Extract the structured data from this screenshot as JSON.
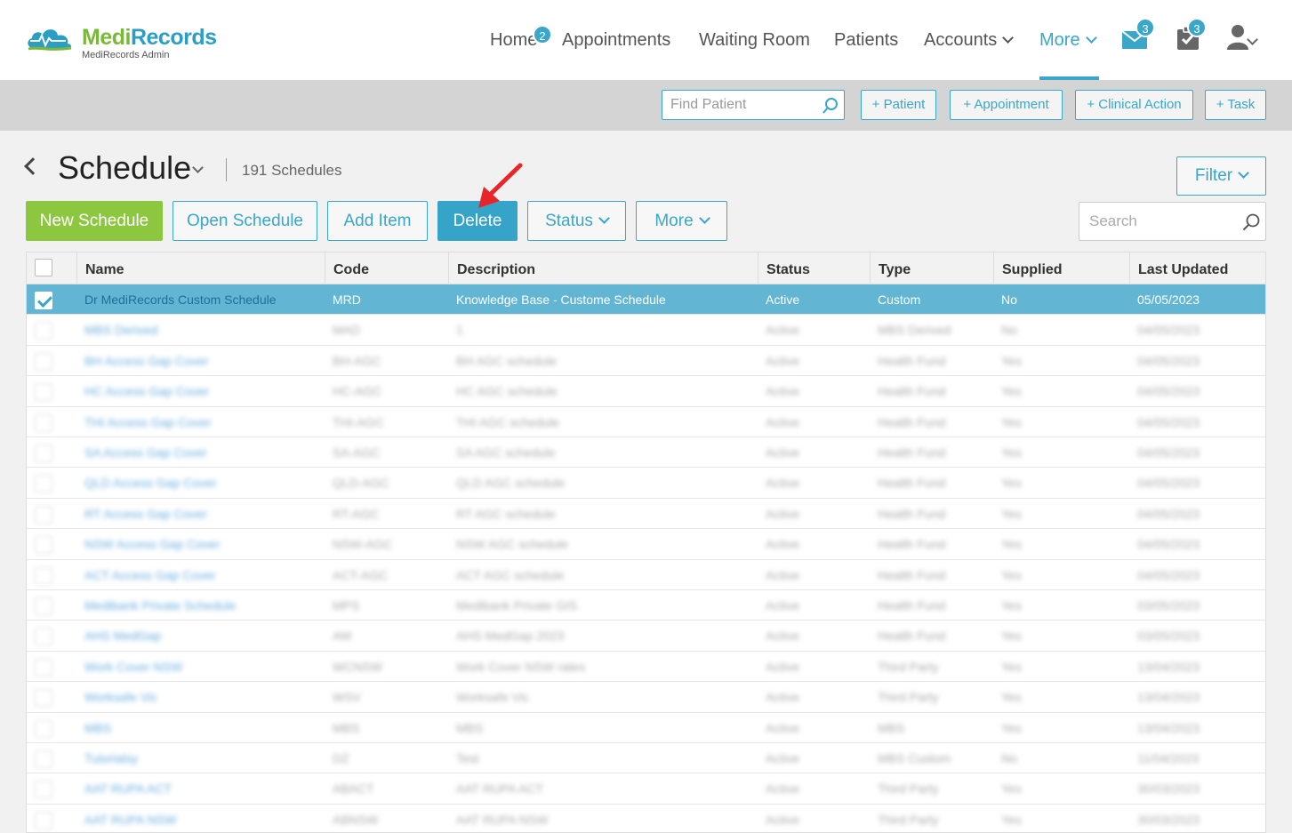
{
  "app": {
    "brand_part1": "Medi",
    "brand_part2": "Records",
    "subtitle": "MediRecords Admin"
  },
  "nav": {
    "home": "Home",
    "home_badge": "2",
    "appointments": "Appointments",
    "waiting_room": "Waiting Room",
    "patients": "Patients",
    "accounts": "Accounts",
    "more": "More",
    "messages_badge": "3",
    "tasks_badge": "3"
  },
  "toolbar": {
    "find_placeholder": "Find Patient",
    "add_patient": "+ Patient",
    "add_appointment": "+ Appointment",
    "add_clinical_action": "+ Clinical Action",
    "add_task": "+ Task"
  },
  "page": {
    "title": "Schedule",
    "count": "191 Schedules",
    "filter": "Filter"
  },
  "actions": {
    "new_schedule": "New Schedule",
    "open_schedule": "Open Schedule",
    "add_item": "Add Item",
    "delete": "Delete",
    "status": "Status",
    "more": "More",
    "search_placeholder": "Search"
  },
  "table": {
    "headers": [
      "Name",
      "Code",
      "Description",
      "Status",
      "Type",
      "Supplied",
      "Last Updated"
    ],
    "rows": [
      {
        "checked": true,
        "cells": [
          "Dr MediRecords Custom Schedule",
          "MRD",
          "Knowledge Base - Custome Schedule",
          "Active",
          "Custom",
          "No",
          "05/05/2023"
        ]
      },
      {
        "checked": false,
        "cells": [
          "MBS Derived",
          "MAD",
          "1",
          "Active",
          "MBS Derived",
          "No",
          "04/05/2023"
        ]
      },
      {
        "checked": false,
        "cells": [
          "BH Access Gap Cover",
          "BH-AGC",
          "BH AGC schedule",
          "Active",
          "Health Fund",
          "Yes",
          "04/05/2023"
        ]
      },
      {
        "checked": false,
        "cells": [
          "HC Access Gap Cover",
          "HC-AGC",
          "HC AGC schedule",
          "Active",
          "Health Fund",
          "Yes",
          "04/05/2023"
        ]
      },
      {
        "checked": false,
        "cells": [
          "THI Access Gap Cover",
          "THI-AGC",
          "THI AGC schedule",
          "Active",
          "Health Fund",
          "Yes",
          "04/05/2023"
        ]
      },
      {
        "checked": false,
        "cells": [
          "SA Access Gap Cover",
          "SA-AGC",
          "SA AGC schedule",
          "Active",
          "Health Fund",
          "Yes",
          "04/05/2023"
        ]
      },
      {
        "checked": false,
        "cells": [
          "QLD Access Gap Cover",
          "QLD-AGC",
          "QLD AGC schedule",
          "Active",
          "Health Fund",
          "Yes",
          "04/05/2023"
        ]
      },
      {
        "checked": false,
        "cells": [
          "RT Access Gap Cover",
          "RT-AGC",
          "RT AGC schedule",
          "Active",
          "Health Fund",
          "Yes",
          "04/05/2023"
        ]
      },
      {
        "checked": false,
        "cells": [
          "NSW Access Gap Cover",
          "NSW-AGC",
          "NSW AGC schedule",
          "Active",
          "Health Fund",
          "Yes",
          "04/05/2023"
        ]
      },
      {
        "checked": false,
        "cells": [
          "ACT Access Gap Cover",
          "ACT-AGC",
          "ACT AGC schedule",
          "Active",
          "Health Fund",
          "Yes",
          "04/05/2023"
        ]
      },
      {
        "checked": false,
        "cells": [
          "Medibank Private Schedule",
          "MPS",
          "Medibank Private GIS",
          "Active",
          "Health Fund",
          "Yes",
          "03/05/2023"
        ]
      },
      {
        "checked": false,
        "cells": [
          "AHS MedGap",
          "AM",
          "AHS MedGap 2023",
          "Active",
          "Health Fund",
          "Yes",
          "03/05/2023"
        ]
      },
      {
        "checked": false,
        "cells": [
          "Work Cover NSW",
          "WCNSW",
          "Work Cover NSW rates",
          "Active",
          "Third Party",
          "Yes",
          "13/04/2023"
        ]
      },
      {
        "checked": false,
        "cells": [
          "Worksafe Vic",
          "WSV",
          "Worksafe Vic",
          "Active",
          "Third Party",
          "Yes",
          "13/04/2023"
        ]
      },
      {
        "checked": false,
        "cells": [
          "MBS",
          "MBS",
          "MBS",
          "Active",
          "MBS",
          "Yes",
          "13/04/2023"
        ]
      },
      {
        "checked": false,
        "cells": [
          "Tutorialsy",
          "DZ",
          "Test",
          "Active",
          "MBS Custom",
          "No",
          "11/04/2023"
        ]
      },
      {
        "checked": false,
        "cells": [
          "AAT RUPA ACT",
          "ABACT",
          "AAT RUPA ACT",
          "Active",
          "Third Party",
          "Yes",
          "30/03/2023"
        ]
      },
      {
        "checked": false,
        "cells": [
          "AAT RUPA NSW",
          "ABNSW",
          "AAT RUPA NSW",
          "Active",
          "Third Party",
          "Yes",
          "30/03/2023"
        ]
      }
    ]
  },
  "colors": {
    "brand_green": "#7ab83a",
    "brand_blue": "#2b9ec4",
    "accent": "#3aa6c9",
    "selected_row": "#62b6d4",
    "annotation_arrow": "#e8262a"
  }
}
